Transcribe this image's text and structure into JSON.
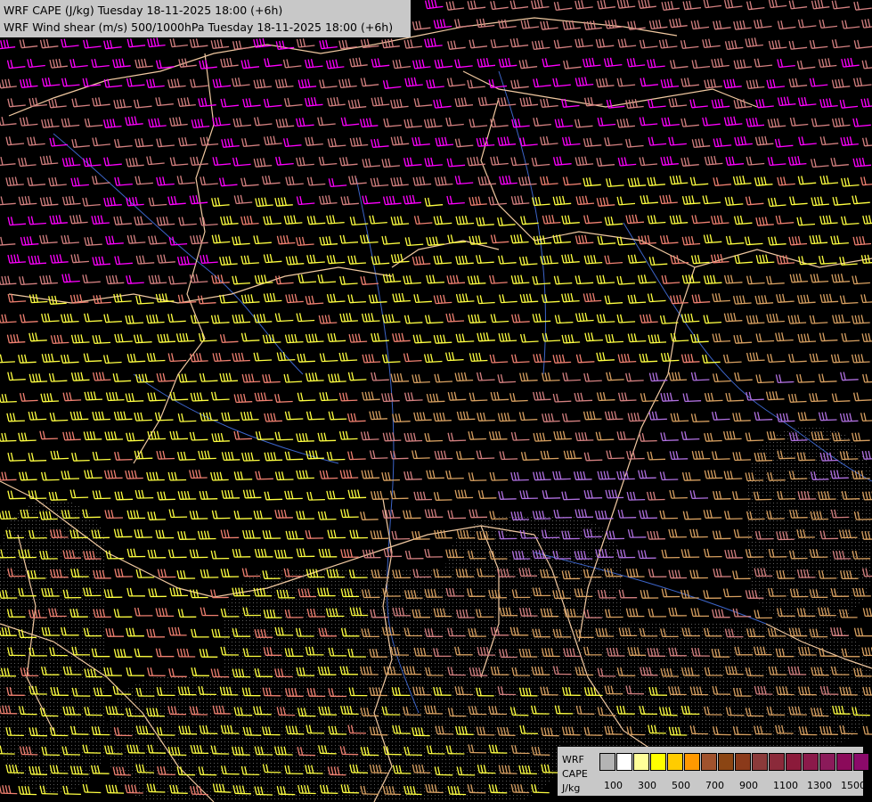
{
  "title": {
    "line1": "WRF CAPE (J/kg) Tuesday 18-11-2025 18:00 (+6h)",
    "line2": "WRF Wind shear (m/s) 500/1000hPa Tuesday 18-11-2025 18:00 (+6h)"
  },
  "legend": {
    "label_model": "WRF",
    "label_field": "CAPE",
    "label_unit": "J/kg",
    "colors": [
      "#b4b4b4",
      "#ffffff",
      "#ffff99",
      "#ffff00",
      "#ffcc00",
      "#ff9900",
      "#a0522d",
      "#8b4513",
      "#8b3a1a",
      "#8b3a3a",
      "#8b2a3a",
      "#8b1a3a",
      "#8b1a4a",
      "#8b1a5a",
      "#8b0a5a",
      "#8b0a6a"
    ],
    "ticks": [
      "100",
      "300",
      "500",
      "700",
      "900",
      "1100",
      "1300",
      "1500"
    ]
  },
  "colors": {
    "background": "#000000",
    "boundary": "#f0c8a0",
    "river": "#3c64c8",
    "wind_magenta": "#ff00ff",
    "wind_pink": "#d48080",
    "wind_salmon": "#f08070",
    "wind_yellow": "#ffff40",
    "wind_tan": "#d8a060",
    "wind_violet": "#b070e0"
  }
}
